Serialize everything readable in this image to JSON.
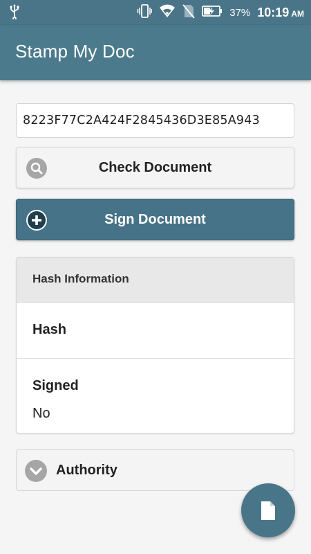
{
  "status_bar": {
    "icons": [
      "usb-icon",
      "vibrate-icon",
      "wifi-icon",
      "no-sim-icon",
      "battery-charging-icon"
    ],
    "battery": "37%",
    "time": "10:19",
    "ampm": "AM"
  },
  "app_bar": {
    "title": "Stamp My Doc"
  },
  "hash_input": {
    "value": "8223F77C2A424F2845436D3E85A943"
  },
  "buttons": {
    "check": {
      "label": "Check Document",
      "icon": "search-icon"
    },
    "sign": {
      "label": "Sign Document",
      "icon": "plus-circle-icon"
    }
  },
  "hash_card": {
    "header": "Hash Information",
    "hash_label": "Hash",
    "hash_value": "",
    "signed_label": "Signed",
    "signed_value": "No"
  },
  "authority": {
    "label": "Authority",
    "icon": "chevron-down-icon"
  },
  "fab": {
    "icon": "document-icon"
  },
  "colors": {
    "primary": "#4a7a8c",
    "status_bar": "#4a7588",
    "sign_button": "#467387",
    "icon_gray": "#9e9e9e"
  }
}
